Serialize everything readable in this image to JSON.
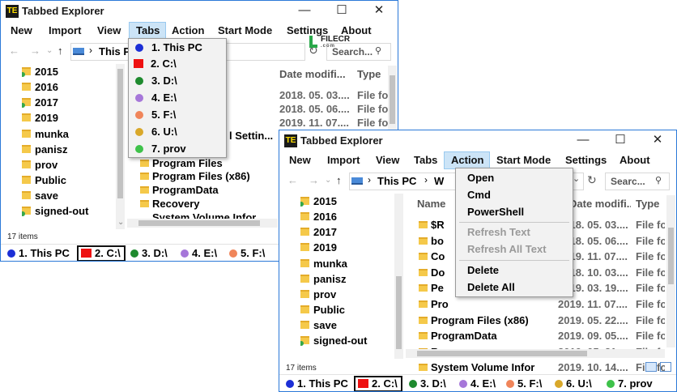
{
  "watermark": {
    "name": "FILECR",
    "sub": ".com"
  },
  "window_back": {
    "title": "Tabbed Explorer",
    "app_icon_text": "TE",
    "controls": {
      "minimize": "—",
      "maximize": "☐",
      "close": "✕"
    },
    "menu": [
      "New",
      "Import",
      "View",
      "Tabs",
      "Action",
      "Start Mode",
      "Settings",
      "About"
    ],
    "address": "This PC",
    "search_placeholder": "Search...",
    "tree": [
      "2015",
      "2016",
      "2017",
      "2019",
      "munka",
      "panisz",
      "prov",
      "Public",
      "save",
      "signed-out"
    ],
    "columns": {
      "date": "Date modifi...",
      "type": "Type"
    },
    "rows": [
      {
        "date": "2018. 05. 03....",
        "type": "File fo"
      },
      {
        "date": "2018. 05. 06....",
        "type": "File fo"
      },
      {
        "date": "2019. 11. 07....",
        "type": "File fo"
      }
    ],
    "partial_rows": [
      "l Settin..."
    ],
    "file_rows": [
      "Program Files",
      "Program Files (x86)",
      "ProgramData",
      "Recovery",
      "System Volume Infor"
    ],
    "status": "17 items",
    "tabs": [
      "1. This PC",
      "2. C:\\",
      "3. D:\\",
      "4. E:\\",
      "5. F:\\"
    ],
    "tabs_menu": [
      "1. This PC",
      "2. C:\\",
      "3. D:\\",
      "4. E:\\",
      "5. F:\\",
      "6. U:\\",
      "7. prov"
    ]
  },
  "window_front": {
    "title": "Tabbed Explorer",
    "app_icon_text": "TE",
    "controls": {
      "minimize": "—",
      "maximize": "☐",
      "close": "✕"
    },
    "menu": [
      "New",
      "Import",
      "View",
      "Tabs",
      "Action",
      "Start Mode",
      "Settings",
      "About"
    ],
    "address": "This PC",
    "address_next": "W",
    "search_placeholder": "Searc...",
    "tree": [
      "2015",
      "2016",
      "2017",
      "2019",
      "munka",
      "panisz",
      "prov",
      "Public",
      "save",
      "signed-out"
    ],
    "columns": {
      "name": "Name",
      "date": "Date modifi...",
      "type": "Type"
    },
    "rows": [
      {
        "name": "$R",
        "date": "2018. 05. 03....",
        "type": "File fo"
      },
      {
        "name": "bo",
        "date": "2018. 05. 06....",
        "type": "File fo"
      },
      {
        "name": "Co",
        "date": "2019. 11. 07....",
        "type": "File fo"
      },
      {
        "name": "Do",
        "date": "2018. 10. 03....",
        "type": "File fo"
      },
      {
        "name": "Pe",
        "date": "2019. 03. 19....",
        "type": "File fo"
      },
      {
        "name": "Pro",
        "date": "2019. 11. 07....",
        "type": "File fo"
      },
      {
        "name": "Program Files (x86)",
        "date": "2019. 05. 22....",
        "type": "File fo"
      },
      {
        "name": "ProgramData",
        "date": "2019. 09. 05....",
        "type": "File fo"
      },
      {
        "name": "Recovery",
        "date": "2019. 05. 21....",
        "type": "File fo"
      },
      {
        "name": "System Volume Infor",
        "date": "2019. 10. 14....",
        "type": "File fo"
      }
    ],
    "status": "17 items",
    "tabs": [
      "1. This PC",
      "2. C:\\",
      "3. D:\\",
      "4. E:\\",
      "5. F:\\",
      "6. U:\\",
      "7. prov"
    ],
    "action_menu": {
      "items": [
        "Open",
        "Cmd",
        "PowerShell"
      ],
      "disabled": [
        "Refresh Text",
        "Refresh All Text"
      ],
      "delete_items": [
        "Delete",
        "Delete All"
      ]
    }
  },
  "tab_colors": {
    "this_pc": "#1c2fd6",
    "c": "#ee1111",
    "d": "#1e8a2e",
    "e": "#a677d9",
    "f": "#f0855a",
    "u": "#d9a82a",
    "prov": "#3ec24a"
  }
}
